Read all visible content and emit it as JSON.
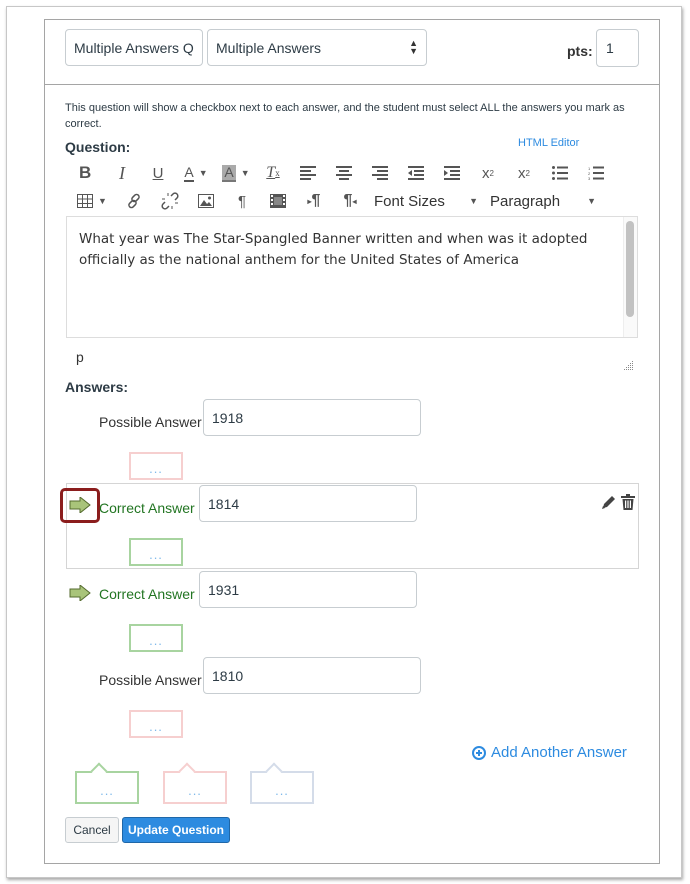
{
  "header": {
    "title_value": "Multiple Answers Q",
    "type_select_value": "Multiple Answers",
    "points_label": "pts:",
    "points_value": "1"
  },
  "help_text": "This question will show a checkbox next to each answer, and the student must select ALL the answers you mark as correct.",
  "question": {
    "label": "Question:",
    "html_editor_link": "HTML Editor",
    "toolbar": {
      "font_sizes": "Font Sizes",
      "paragraph": "Paragraph",
      "icons": [
        "bold-icon",
        "italic-icon",
        "underline-icon",
        "text-color-icon",
        "background-color-icon",
        "clear-formatting-icon",
        "align-left-icon",
        "align-center-icon",
        "align-right-icon",
        "outdent-icon",
        "indent-icon",
        "superscript-icon",
        "subscript-icon",
        "bullet-list-icon",
        "numbered-list-icon",
        "table-icon",
        "link-icon",
        "unlink-icon",
        "image-icon",
        "paragraph-mark-icon",
        "media-icon",
        "ltr-icon",
        "rtl-icon"
      ]
    },
    "body_text": "What year was The Star-Spangled Banner written and when was it adopted officially as the national anthem for the United States of America",
    "path_indicator": "p"
  },
  "answers": {
    "label": "Answers:",
    "items": [
      {
        "type": "Possible Answer",
        "value": "1918",
        "correct": false,
        "comment": "..."
      },
      {
        "type": "Correct Answer",
        "value": "1814",
        "correct": true,
        "comment": "..."
      },
      {
        "type": "Correct Answer",
        "value": "1931",
        "correct": true,
        "comment": "..."
      },
      {
        "type": "Possible Answer",
        "value": "1810",
        "correct": false,
        "comment": "..."
      }
    ],
    "add_answer_label": "Add Another Answer"
  },
  "general_comments": {
    "correct": "...",
    "incorrect": "...",
    "neutral": "..."
  },
  "buttons": {
    "cancel": "Cancel",
    "update": "Update Question"
  },
  "colors": {
    "accent": "#2d8be0",
    "correct_text": "#227522",
    "highlight_ring": "#8b1d1d"
  }
}
